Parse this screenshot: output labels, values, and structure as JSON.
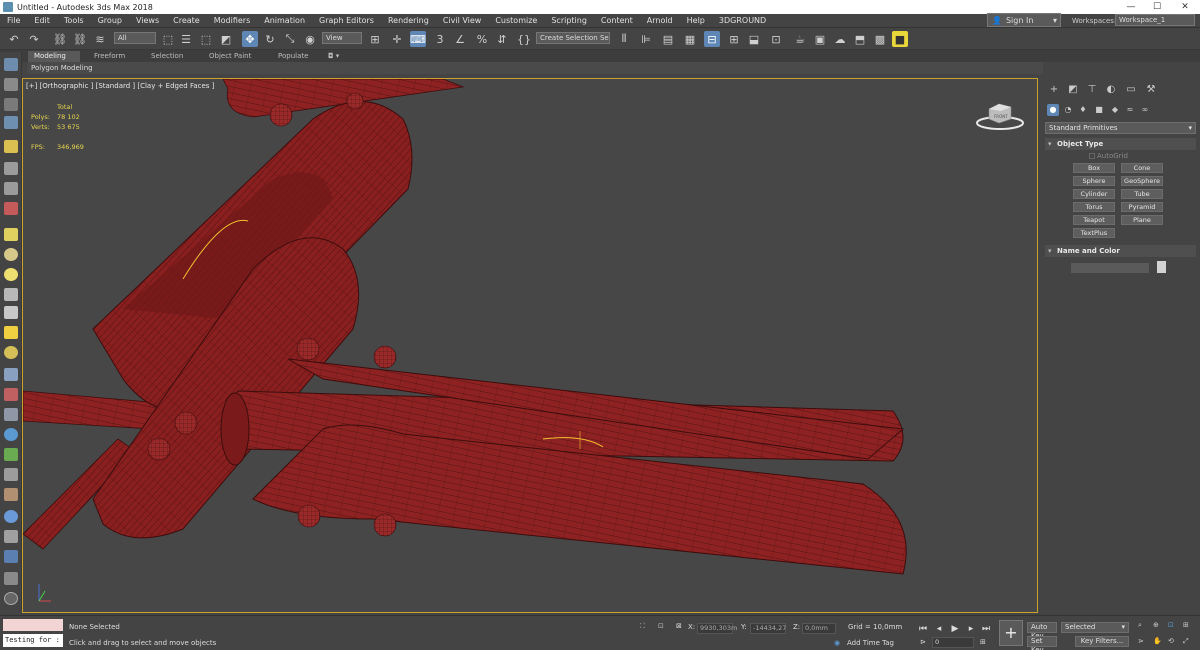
{
  "window": {
    "title": "Untitled - Autodesk 3ds Max 2018"
  },
  "menu": [
    "File",
    "Edit",
    "Tools",
    "Group",
    "Views",
    "Create",
    "Modifiers",
    "Animation",
    "Graph Editors",
    "Rendering",
    "Civil View",
    "Customize",
    "Scripting",
    "Content",
    "Arnold",
    "Help",
    "3DGROUND"
  ],
  "account": {
    "sign_in": "Sign In",
    "workspaces_label": "Workspaces:",
    "workspace_value": "Workspace_1"
  },
  "toolbar": {
    "selection_filter": "All",
    "ref_coord": "View",
    "named_selection": "Create Selection Se",
    "icons": [
      "undo-icon",
      "redo-icon",
      "link-icon",
      "unlink-icon",
      "bind-spacewarp-icon",
      "select-object-icon",
      "select-by-name-icon",
      "rect-selection-icon",
      "window-crossing-icon",
      "move-icon",
      "rotate-icon",
      "scale-icon",
      "place-icon",
      "pivot-icon",
      "manipulate-icon",
      "keyboard-shortcut-icon",
      "snaps-3d-icon",
      "angle-snap-icon",
      "percent-snap-icon",
      "spinner-snap-icon",
      "edit-named-sel-icon",
      "mirror-icon",
      "align-icon",
      "layer-explorer-icon",
      "toggle-ribbon-icon",
      "curve-editor-icon",
      "schematic-view-icon",
      "material-editor-icon",
      "render-setup-icon",
      "rendered-frame-icon",
      "render-icon",
      "render-cloud-icon",
      "a360-icon"
    ]
  },
  "ribbon": {
    "tabs": [
      "Modeling",
      "Freeform",
      "Selection",
      "Object Paint",
      "Populate"
    ],
    "active_tab": "Modeling",
    "sub_label": "Polygon Modeling"
  },
  "viewport": {
    "label": "[+] [Orthographic ] [Standard ] [Clay + Edged Faces ]",
    "stats": {
      "total_label": "Total",
      "polys_label": "Polys:",
      "polys_value": "78 102",
      "verts_label": "Verts:",
      "verts_value": "53 675",
      "fps_label": "FPS:",
      "fps_value": "346,969"
    },
    "viewcube_label": "FRONT",
    "colors": {
      "background": "#474747",
      "model": "#8a1f1f",
      "model_light": "#a23030",
      "wire": "#3d0d0d",
      "highlight": "#f2c230",
      "border": "#c9a32b"
    }
  },
  "command_panel": {
    "tabs": [
      "create-icon",
      "modify-icon",
      "hierarchy-icon",
      "motion-icon",
      "display-icon",
      "utilities-icon"
    ],
    "sub_tabs": [
      "geometry-icon",
      "shapes-icon",
      "lights-icon",
      "cameras-icon",
      "helpers-icon",
      "spacewarps-icon",
      "systems-icon"
    ],
    "category": "Standard Primitives",
    "object_type_header": "Object Type",
    "autogrid": "AutoGrid",
    "primitives": [
      "Box",
      "Cone",
      "Sphere",
      "GeoSphere",
      "Cylinder",
      "Tube",
      "Torus",
      "Pyramid",
      "Teapot",
      "Plane",
      "TextPlus"
    ],
    "name_color_header": "Name and Color"
  },
  "status": {
    "maxscript_text": "Testing for :",
    "selection": "None Selected",
    "prompt": "Click and drag to select and move objects",
    "x_label": "X:",
    "x_value": "9930,303m",
    "y_label": "Y:",
    "y_value": "-14434,27",
    "z_label": "Z:",
    "z_value": "0,0mm",
    "grid": "Grid = 10,0mm",
    "add_time_tag": "Add Time Tag",
    "frame": "0",
    "auto_key": "Auto Key",
    "set_key": "Set Key",
    "key_mode": "Selected",
    "key_filters": "Key Filters..."
  }
}
